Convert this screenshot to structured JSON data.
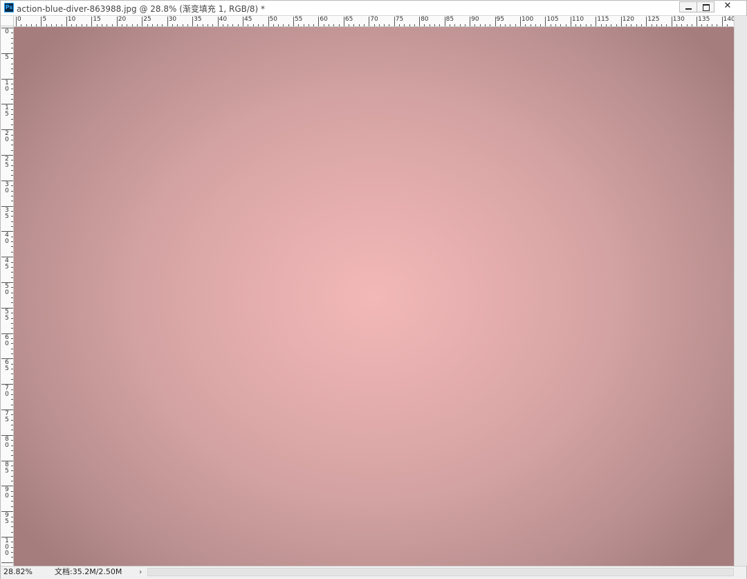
{
  "window": {
    "app_icon": "photoshop-icon",
    "app_icon_text": "Ps",
    "title": "action-blue-diver-863988.jpg @ 28.8% (渐变填充 1, RGB/8) *",
    "buttons": {
      "minimize": "minimize-icon",
      "maximize": "maximize-icon",
      "close": "✕"
    }
  },
  "ruler_top": {
    "labels": [
      "0",
      "5",
      "10",
      "15",
      "20",
      "25",
      "30",
      "35",
      "40",
      "45",
      "50",
      "55",
      "60",
      "65",
      "70",
      "75",
      "80",
      "85",
      "90",
      "95",
      "100",
      "105",
      "110",
      "115",
      "120",
      "125",
      "130",
      "135",
      "140"
    ]
  },
  "ruler_left": {
    "labels": [
      "0",
      "5",
      "10",
      "15",
      "20",
      "25",
      "30",
      "35",
      "40",
      "45",
      "50",
      "55",
      "60",
      "65",
      "70",
      "75",
      "80",
      "85",
      "90",
      "95",
      "100"
    ]
  },
  "canvas": {
    "fill": "radial-gradient",
    "center_color": "#f2b8b8",
    "edge_color": "#a57d7d"
  },
  "status": {
    "zoom": "28.82%",
    "doc_info": "文档:35.2M/2.50M",
    "arrow": "›"
  }
}
